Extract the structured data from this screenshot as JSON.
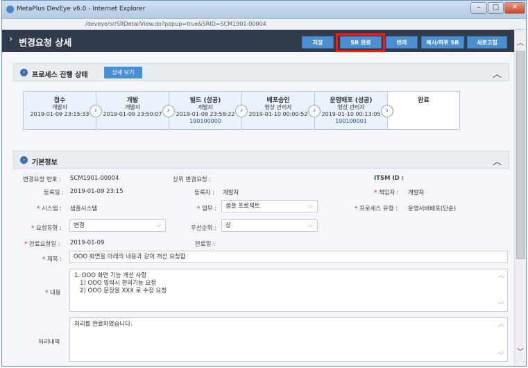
{
  "window": {
    "title": "MetaPlus DevEye v6.0 - Internet Explorer",
    "url": "/deveye/sr/SRDetailView.do?popup=true&SRID=SCM1901-00004",
    "controls": {
      "minimize": "–",
      "maximize": "□",
      "close": "✕"
    }
  },
  "header": {
    "title": "변경요청 상세",
    "buttons": {
      "save": "저장",
      "complete": "SR 완료",
      "reject": "반려",
      "copy": "복사/하위 SR",
      "refresh": "새로고침"
    }
  },
  "process": {
    "title": "프로세스 진행 상태",
    "view_button": "상세 보기",
    "steps": [
      {
        "name": "접수",
        "role": "개발자",
        "date": "2019-01-09 23:15:33",
        "num": ""
      },
      {
        "name": "개발",
        "role": "개발자",
        "date": "2019-01-09 23:50:07",
        "num": ""
      },
      {
        "name": "빌드 (성공)",
        "role": "개발자",
        "date": "2019-01-09 23:58:22",
        "num": "190100000"
      },
      {
        "name": "배포승인",
        "role": "형상 관리자",
        "date": "2019-01-10 00:00:52",
        "num": ""
      },
      {
        "name": "운영배포 (성공)",
        "role": "형상 관리자",
        "date": "2019-01-10 00:13:05",
        "num": "190100001"
      },
      {
        "name": "완료",
        "role": "",
        "date": "",
        "num": ""
      }
    ]
  },
  "basic": {
    "title": "기본정보",
    "sr_no_label": "변경요청 번호 :",
    "sr_no": "SCM1901-00004",
    "parent_label": "상위 변경요청 :",
    "itsm_label": "ITSM ID :",
    "reg_date_label": "등록일 :",
    "reg_date": "2019-01-09 23:15",
    "registrant_label": "등록자 :",
    "registrant": "개발자",
    "owner_label": "책임자 :",
    "owner": "개발자",
    "system_label": "시스템 :",
    "system": "샘플시스템",
    "task_label": "업무 :",
    "task": "샘플 프로젝트",
    "proc_type_label": "프로세스 유형 :",
    "proc_type": "운영서버배포(단순)",
    "req_type_label": "요청유형 :",
    "req_type": "변경",
    "priority_label": "우선순위 :",
    "priority": "상",
    "due_label": "완료요청일 :",
    "due": "2019-01-09",
    "done_label": "완료일 :",
    "subject_label": "제목 :",
    "subject": "OOO 화면을 아래의 내용과 같이 개선 요청함",
    "content_label": "내용",
    "content_lines": [
      "1. OOO 화면 기능 개선 사항",
      "   1) OOO 입력시 편의기능 요청",
      "   2) OOO 문장을 XXX 로 수정 요청"
    ],
    "history_label": "처리내역",
    "history": "처리를 완료하였습니다."
  }
}
